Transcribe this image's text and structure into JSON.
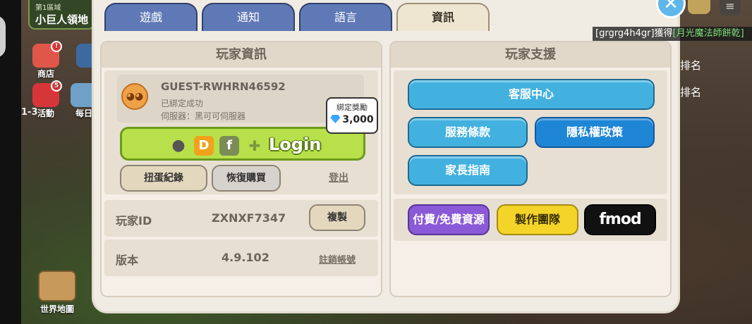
{
  "region": {
    "line1": "第1區域",
    "line2": "小巨人領地"
  },
  "side_icons": [
    {
      "label": "商店",
      "badge": "!"
    },
    {
      "label": "活動",
      "badge": "5"
    },
    {
      "label": "每日"
    },
    {
      "label": "1-3"
    }
  ],
  "world_map": "世界地圖",
  "rank_labels": [
    "排名",
    "排名"
  ],
  "ticker": {
    "prefix": "[grgrg4h4gr]獲得",
    "item": "[月光魔法師餅乾]"
  },
  "tabs": [
    "遊戲",
    "通知",
    "語言",
    "資訊"
  ],
  "active_tab": 3,
  "player_info": {
    "title": "玩家資訊",
    "account_id": "GUEST-RWHRN46592",
    "bind_status": "已綁定成功",
    "server": "伺服器：黑可可伺服器",
    "bonus_title": "綁定獎勵",
    "bonus_value": "3,000",
    "login_label": "Login",
    "login_icons": [
      "D",
      "f"
    ],
    "gacha_button": "扭蛋紀錄",
    "restore_button": "恢復購買",
    "logout": "登出",
    "player_id_label": "玩家ID",
    "player_id_value": "ZXNXF7347",
    "copy_button": "複製",
    "version_label": "版本",
    "version_value": "4.9.102",
    "delete_account": "註銷帳號"
  },
  "player_support": {
    "title": "玩家支援",
    "customer_center": "客服中心",
    "terms": "服務條款",
    "privacy": "隱私權政策",
    "parent_guide": "家長指南",
    "paid_free": "付費/免費資源",
    "credits": "製作團隊",
    "fmod": "fmod"
  },
  "colors": {
    "tab_inactive": "#5f79b6",
    "tab_active": "#efe6d2",
    "login_green": "#b7e04a",
    "cyan_button": "#43b1df",
    "blue_button": "#1f86d6",
    "purple_button": "#8a5ad6",
    "yellow_button": "#f4d428"
  }
}
